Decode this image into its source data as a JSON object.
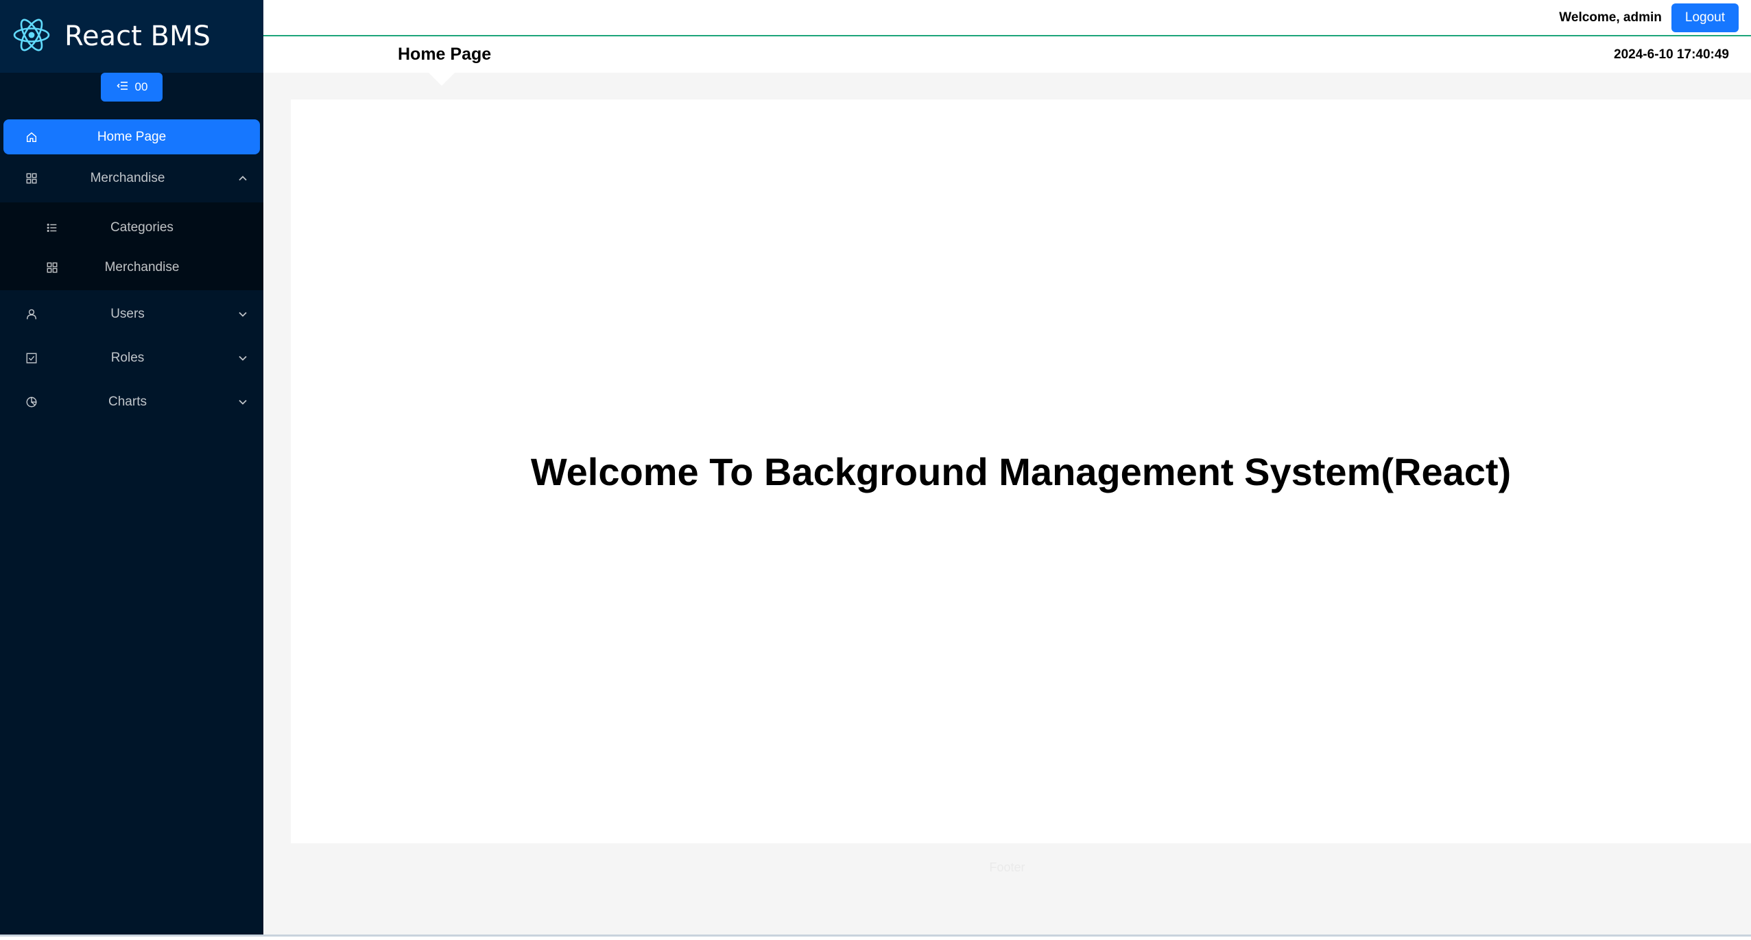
{
  "sidebar": {
    "logo_text": "React BMS",
    "collapse_label": "00",
    "items": [
      {
        "label": "Home Page"
      },
      {
        "label": "Merchandise"
      },
      {
        "label": "Categories"
      },
      {
        "label": "Merchandise"
      },
      {
        "label": "Users"
      },
      {
        "label": "Roles"
      },
      {
        "label": "Charts"
      }
    ]
  },
  "header": {
    "welcome": "Welcome, admin",
    "logout_label": "Logout",
    "page_title": "Home Page",
    "datetime": "2024-6-10 17:40:49"
  },
  "main": {
    "welcome_heading": "Welcome To Background Management System(React)"
  },
  "footer": {
    "text": "Footer"
  },
  "colors": {
    "sidebar_bg": "#001529",
    "accent": "#1677ff",
    "header_divider": "#1da57a"
  }
}
